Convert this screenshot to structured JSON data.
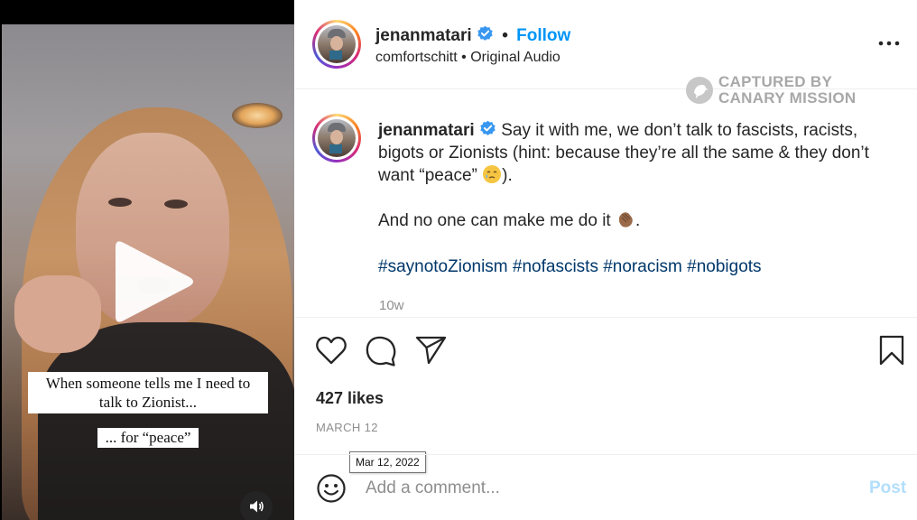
{
  "video": {
    "overlay_caption_line1": "When someone tells me I need to",
    "overlay_caption_line2": "talk to Zionist...",
    "overlay_caption_small": "... for “peace”",
    "play_icon": "play-icon",
    "sound_icon": "speaker-icon"
  },
  "header": {
    "username": "jenanmatari",
    "separator": "•",
    "follow_label": "Follow",
    "audio_author": "comfortschitt",
    "audio_separator": "•",
    "audio_title": "Original Audio",
    "more_icon": "more-options-icon"
  },
  "watermark": {
    "line1": "CAPTURED BY",
    "line2": "CANARY MISSION"
  },
  "caption": {
    "username": "jenanmatari",
    "text_part1": "Say it with me, we don’t talk to fascists, racists, bigots or Zionists (hint: because they’re all the same & they don’t want “peace” ",
    "text_part1_end": ").",
    "text_part2": "And no one can make me do it ",
    "text_part2_end": ".",
    "hashtags": "#saynotoZionism #nofascists #noracism #nobigots",
    "time_ago": "10w"
  },
  "actions": {
    "like_icon": "heart-icon",
    "comment_icon": "comment-icon",
    "share_icon": "share-icon",
    "save_icon": "bookmark-icon"
  },
  "stats": {
    "likes": "427 likes",
    "date": "MARCH 12",
    "date_tooltip": "Mar 12, 2022"
  },
  "comment": {
    "emoji_icon": "emoji-icon",
    "placeholder": "Add a comment...",
    "post_label": "Post"
  },
  "colors": {
    "link_blue": "#0095f6",
    "hashtag": "#00376b",
    "muted": "#8e8e8e",
    "post_disabled": "#b2dffc"
  }
}
